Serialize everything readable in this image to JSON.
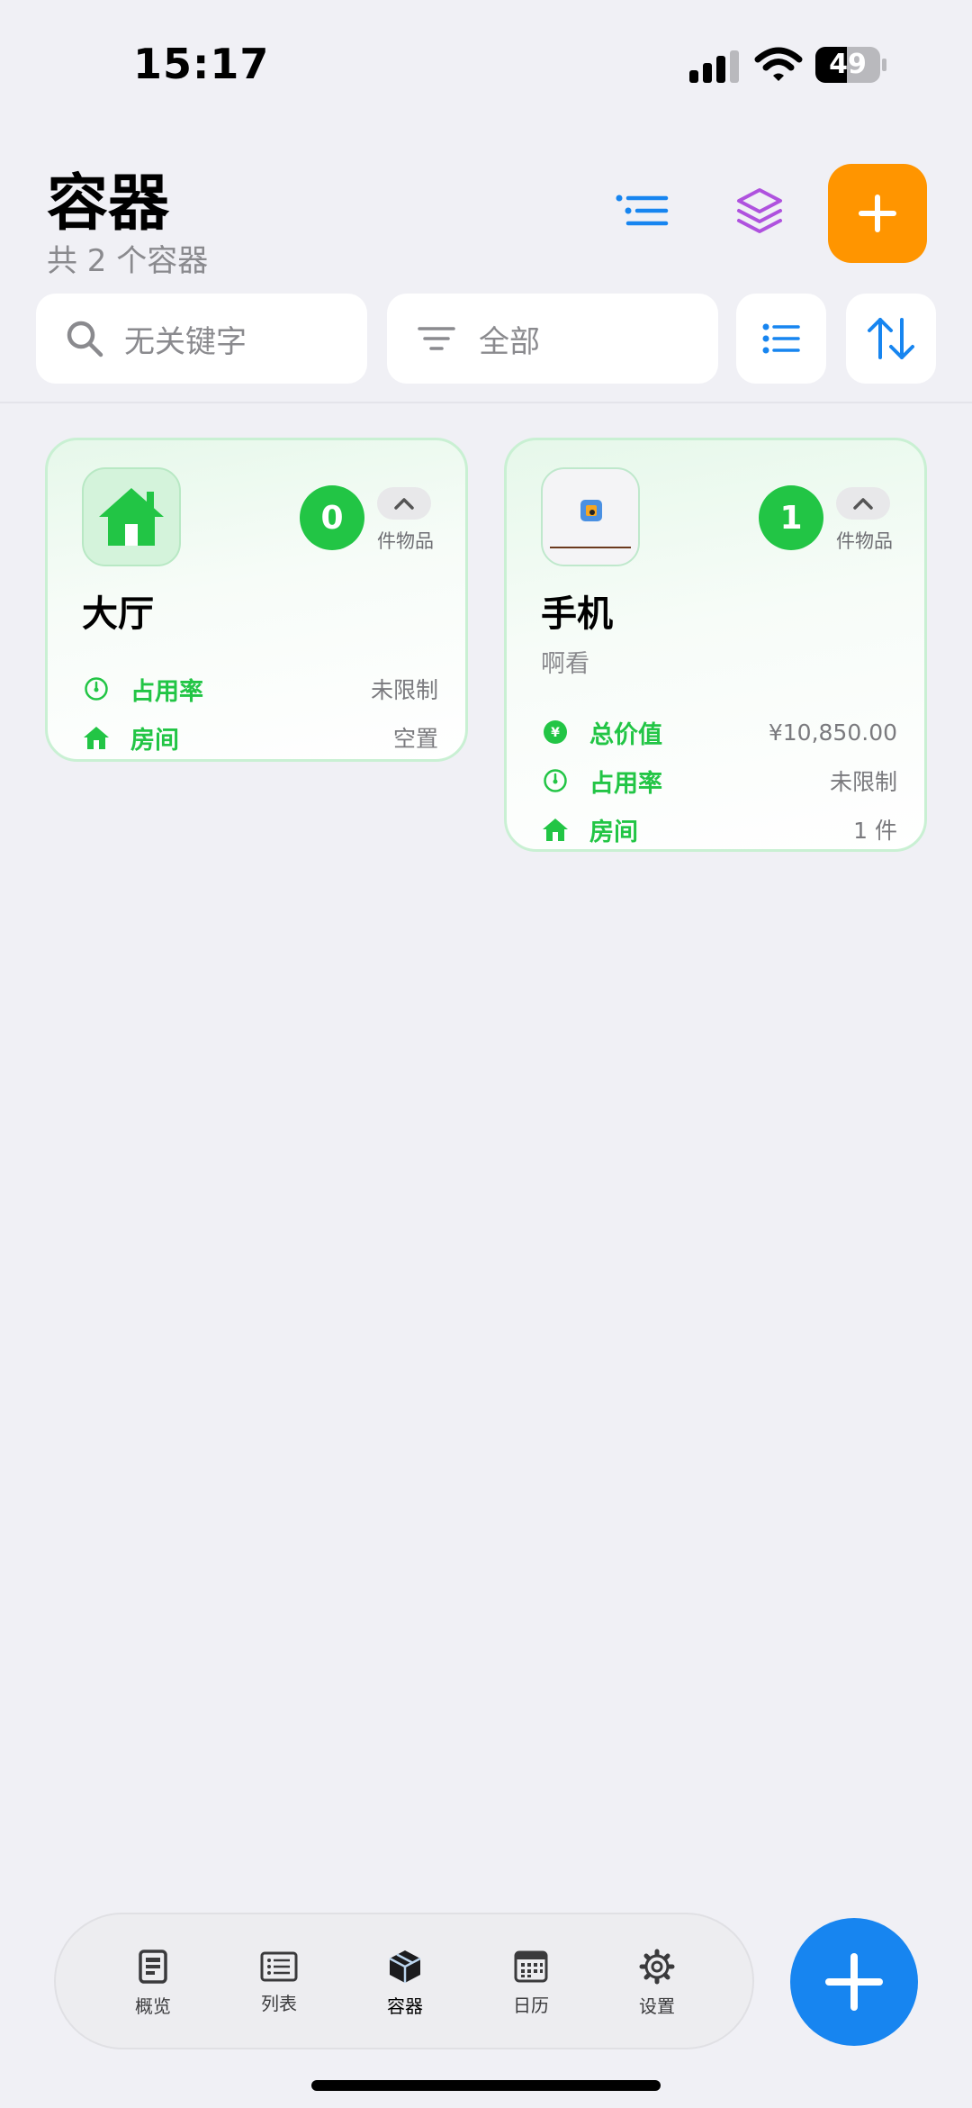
{
  "status_bar": {
    "time": "15:17",
    "battery": "49",
    "battery_level": 0.49
  },
  "header": {
    "title": "容器",
    "subtitle": "共 2 个容器"
  },
  "toolbar": {
    "search_placeholder": "无关键字",
    "filter_label": "全部"
  },
  "containers": [
    {
      "name": "大厅",
      "description": "",
      "count": "0",
      "count_label": "件物品",
      "stats": [
        {
          "icon": "gauge-icon",
          "label": "占用率",
          "value": "未限制"
        },
        {
          "icon": "house-icon",
          "label": "房间",
          "value": "空置"
        }
      ]
    },
    {
      "name": "手机",
      "description": "啊看",
      "count": "1",
      "count_label": "件物品",
      "stats": [
        {
          "icon": "yen-circle-icon",
          "label": "总价值",
          "value": "¥10,850.00"
        },
        {
          "icon": "gauge-icon",
          "label": "占用率",
          "value": "未限制"
        },
        {
          "icon": "house-icon",
          "label": "房间",
          "value": "1 件"
        }
      ]
    }
  ],
  "tabs": [
    {
      "label": "概览",
      "icon": "document-icon"
    },
    {
      "label": "列表",
      "icon": "list-icon"
    },
    {
      "label": "容器",
      "icon": "box-icon",
      "active": true
    },
    {
      "label": "日历",
      "icon": "calendar-icon"
    },
    {
      "label": "设置",
      "icon": "gear-icon"
    }
  ],
  "colors": {
    "accent_green": "#22c545",
    "accent_orange": "#ff9500",
    "accent_blue": "#1785f0",
    "accent_purple": "#af52de"
  }
}
